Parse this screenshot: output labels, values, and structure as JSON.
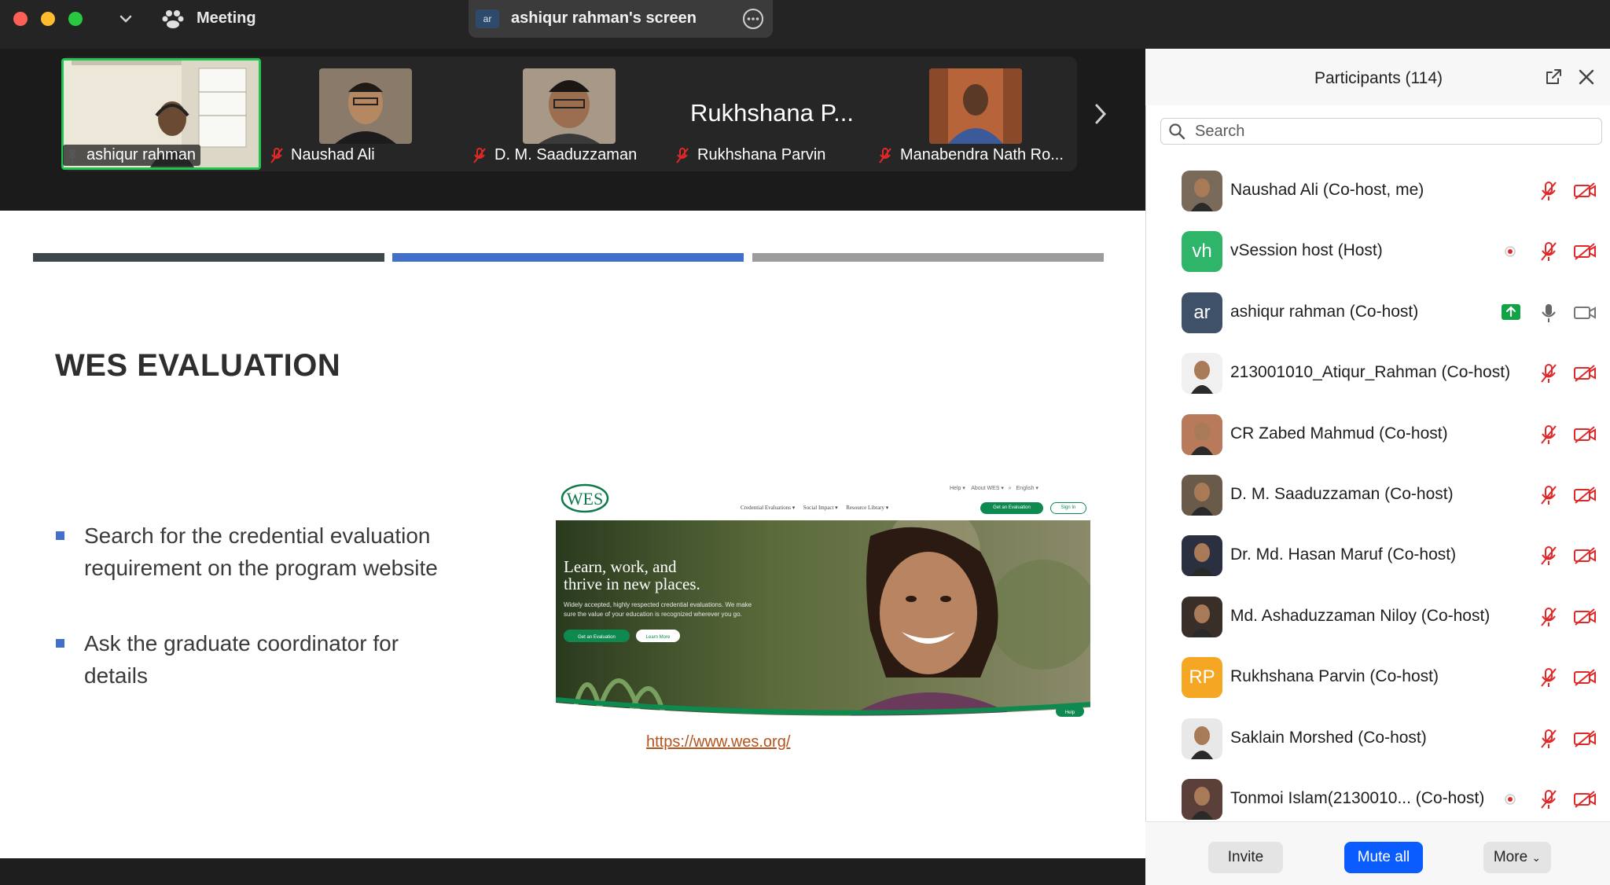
{
  "titlebar": {
    "meeting_label": "Meeting",
    "share_avatar": "ar",
    "share_label": "ashiqur rahman's screen"
  },
  "gallery": {
    "tiles": [
      {
        "name": "ashiqur rahman"
      },
      {
        "name": "Naushad Ali"
      },
      {
        "name": "D. M. Saaduzzaman"
      },
      {
        "name": "Rukhshana Parvin",
        "big_name": "Rukhshana P..."
      },
      {
        "name": "Manabendra Nath Ro..."
      }
    ]
  },
  "slide": {
    "title": "WES EVALUATION",
    "bullets": [
      "Search for the credential evaluation requirement on the program website",
      "Ask the graduate coordinator for details"
    ],
    "website": {
      "logo": "WES",
      "nav_top": [
        "Help",
        "About WES",
        "English"
      ],
      "nav_main": [
        "Credential Evaluations",
        "Social Impact",
        "Resource Library"
      ],
      "cta": "Get an Evaluation",
      "signin": "Sign In",
      "hero_line1": "Learn, work, and",
      "hero_line2": "thrive in new places.",
      "hero_sub1": "Widely accepted, highly respected credential evaluations. We make",
      "hero_sub2": "sure the value of your education is recognized wherever you go.",
      "hero_btn1": "Get an Evaluation",
      "hero_btn2": "Learn More",
      "help": "Help"
    },
    "link": "https://www.wes.org/"
  },
  "panel": {
    "title": "Participants (114)",
    "search_placeholder": "Search",
    "participants": [
      {
        "name": "Naushad Ali (Co-host, me)",
        "avatar": "",
        "avatar_color": "#7a6a5a"
      },
      {
        "name": "vSession host (Host)",
        "avatar": "vh",
        "avatar_color": "#2fb56a",
        "recording": true
      },
      {
        "name": "ashiqur rahman (Co-host)",
        "avatar": "ar",
        "avatar_color": "#3e5168",
        "sharing": true
      },
      {
        "name": "213001010_Atiqur_Rahman (Co-host)",
        "avatar": "",
        "avatar_color": "#f0f0f0"
      },
      {
        "name": "CR Zabed Mahmud (Co-host)",
        "avatar": "",
        "avatar_color": "#b87a5a"
      },
      {
        "name": "D. M. Saaduzzaman (Co-host)",
        "avatar": "",
        "avatar_color": "#6a5a4a"
      },
      {
        "name": "Dr. Md. Hasan Maruf (Co-host)",
        "avatar": "",
        "avatar_color": "#2a3040"
      },
      {
        "name": "Md. Ashaduzzaman Niloy (Co-host)",
        "avatar": "",
        "avatar_color": "#3a2e28"
      },
      {
        "name": "Rukhshana Parvin (Co-host)",
        "avatar": "RP",
        "avatar_color": "#f5a623"
      },
      {
        "name": "Saklain Morshed (Co-host)",
        "avatar": "",
        "avatar_color": "#e8e8e8"
      },
      {
        "name": "Tonmoi Islam(2130010...  (Co-host)",
        "avatar": "",
        "avatar_color": "#5a4038",
        "recording": true
      }
    ],
    "buttons": {
      "invite": "Invite",
      "mute_all": "Mute all",
      "more": "More"
    }
  }
}
